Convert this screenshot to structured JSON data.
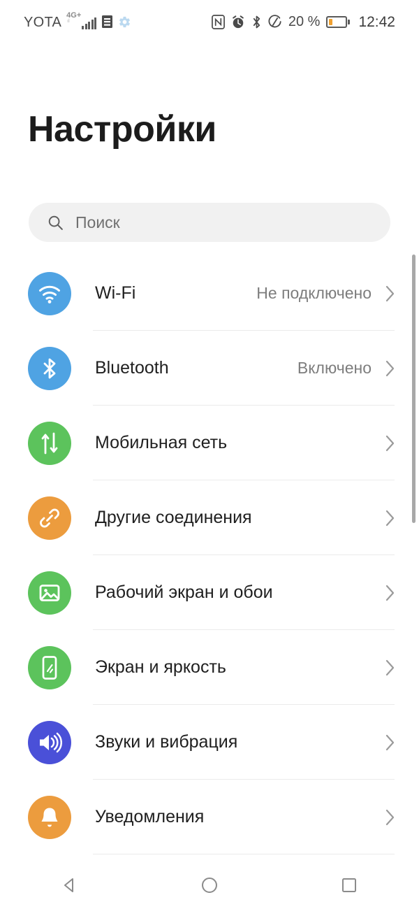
{
  "statusbar": {
    "carrier": "YOTA",
    "network_type": "4G+",
    "signal_sub": "ıl",
    "battery_percent_label": "20 %",
    "battery_level": 20,
    "clock": "12:42",
    "icons_left": [
      "signal-bars-icon",
      "sim-card-icon",
      "settings-gear-icon"
    ],
    "icons_right": [
      "nfc-icon",
      "alarm-icon",
      "bluetooth-icon",
      "data-saver-icon",
      "battery-icon"
    ]
  },
  "header": {
    "title": "Настройки"
  },
  "search": {
    "placeholder": "Поиск",
    "value": "",
    "icon": "search-icon"
  },
  "settings_list": [
    {
      "label": "Wi-Fi",
      "value": "Не подключено",
      "icon": "wifi-icon",
      "color": "#4FA3E3",
      "name": "wifi"
    },
    {
      "label": "Bluetooth",
      "value": "Включено",
      "icon": "bluetooth-icon",
      "color": "#4FA3E3",
      "name": "bluetooth"
    },
    {
      "label": "Мобильная сеть",
      "value": "",
      "icon": "mobile-data-icon",
      "color": "#5CC35C",
      "name": "mobile-network"
    },
    {
      "label": "Другие соединения",
      "value": "",
      "icon": "link-icon",
      "color": "#EC9C3E",
      "name": "other-connections"
    },
    {
      "label": "Рабочий экран и обои",
      "value": "",
      "icon": "wallpaper-icon",
      "color": "#5CC35C",
      "name": "home-screen-wallpaper"
    },
    {
      "label": "Экран и яркость",
      "value": "",
      "icon": "display-icon",
      "color": "#5CC35C",
      "name": "display-brightness"
    },
    {
      "label": "Звуки и вибрация",
      "value": "",
      "icon": "sound-icon",
      "color": "#4A50D8",
      "name": "sound-vibration"
    },
    {
      "label": "Уведомления",
      "value": "",
      "icon": "bell-icon",
      "color": "#EC9C3E",
      "name": "notifications"
    }
  ],
  "navbar": {
    "back": "back-icon",
    "home": "home-icon",
    "recents": "recents-icon"
  },
  "colors": {
    "accent_blue": "#4FA3E3",
    "accent_green": "#5CC35C",
    "accent_orange": "#EC9C3E",
    "accent_indigo": "#4A50D8",
    "battery_orange": "#F0A030",
    "search_background": "#F1F1F1",
    "divider": "#EBEBEB"
  }
}
